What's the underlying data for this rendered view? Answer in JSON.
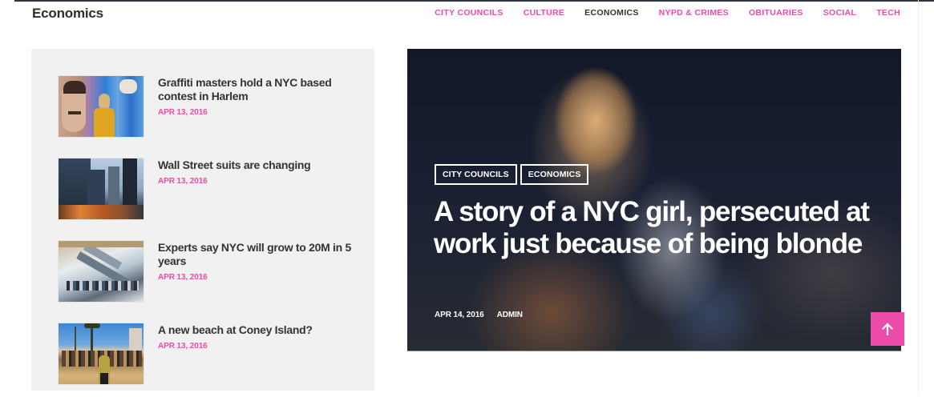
{
  "section": {
    "title": "Economics"
  },
  "nav": {
    "items": [
      {
        "label": "CITY COUNCILS",
        "active": false
      },
      {
        "label": "CULTURE",
        "active": false
      },
      {
        "label": "ECONOMICS",
        "active": true
      },
      {
        "label": "NYPD & CRIMES",
        "active": false
      },
      {
        "label": "OBITUARIES",
        "active": false
      },
      {
        "label": "SOCIAL",
        "active": false
      },
      {
        "label": "TECH",
        "active": false
      }
    ]
  },
  "list": {
    "items": [
      {
        "title": "Graffiti masters hold a NYC based contest in Harlem",
        "date": "APR 13, 2016",
        "thumb_icon": "graffiti-image"
      },
      {
        "title": "Wall Street suits are changing",
        "date": "APR 13, 2016",
        "thumb_icon": "city-buildings-image"
      },
      {
        "title": "Experts say NYC will grow to 20M in 5 years",
        "date": "APR 13, 2016",
        "thumb_icon": "crowd-escalator-image"
      },
      {
        "title": "A new beach at Coney Island?",
        "date": "APR 13, 2016",
        "thumb_icon": "beach-boardwalk-image"
      }
    ]
  },
  "hero": {
    "tags": [
      "CITY COUNCILS",
      "ECONOMICS"
    ],
    "title": "A story of a NYC girl, persecuted at work just because of being blonde",
    "date": "APR 14, 2016",
    "author": "ADMIN",
    "image_icon": "blonde-girl-photo"
  },
  "back_to_top": {
    "icon": "arrow-up-icon"
  },
  "colors": {
    "accent": "#ec4ba9",
    "text_dark": "#333333",
    "panel_bg": "#f2f1f1",
    "hero_bg": "#141a2a"
  }
}
